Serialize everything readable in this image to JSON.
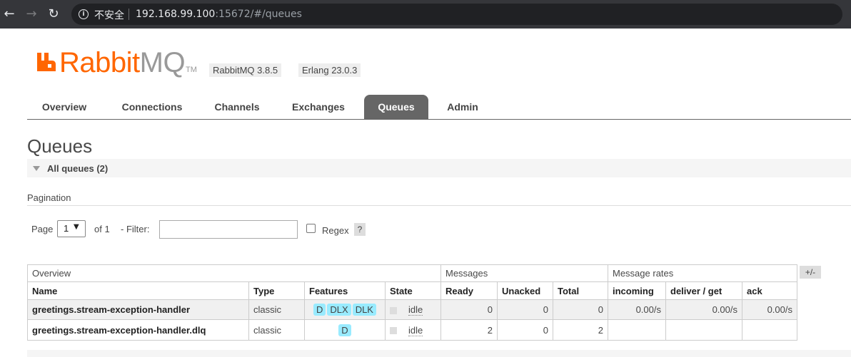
{
  "browser": {
    "security_text": "不安全",
    "url_host": "192.168.99.100",
    "url_rest": ":15672/#/queues"
  },
  "header": {
    "logo_rabbit": "Rabbit",
    "logo_mq": "MQ",
    "logo_tm": "TM",
    "version_rabbitmq": "RabbitMQ 3.8.5",
    "version_erlang": "Erlang 23.0.3",
    "brand_color": "#ff6600"
  },
  "tabs": [
    {
      "label": "Overview"
    },
    {
      "label": "Connections"
    },
    {
      "label": "Channels"
    },
    {
      "label": "Exchanges"
    },
    {
      "label": "Queues",
      "active": true
    },
    {
      "label": "Admin"
    }
  ],
  "main": {
    "title": "Queues",
    "section_label": "All queues (2)",
    "pagination_label": "Pagination",
    "page_word": "Page",
    "page_value": "1",
    "of_text": "of 1",
    "filter_label": "- Filter:",
    "filter_value": "",
    "regex_label": "Regex",
    "help_label": "?",
    "columns_toggle": "+/-"
  },
  "table": {
    "group_headers": [
      "Overview",
      "Messages",
      "Message rates"
    ],
    "headers": [
      "Name",
      "Type",
      "Features",
      "State",
      "Ready",
      "Unacked",
      "Total",
      "incoming",
      "deliver / get",
      "ack"
    ],
    "rows": [
      {
        "name": "greetings.stream-exception-handler",
        "type": "classic",
        "features": [
          "D",
          "DLX",
          "DLK"
        ],
        "state": "idle",
        "ready": "0",
        "unacked": "0",
        "total": "0",
        "incoming": "0.00/s",
        "deliver_get": "0.00/s",
        "ack": "0.00/s"
      },
      {
        "name": "greetings.stream-exception-handler.dlq",
        "type": "classic",
        "features": [
          "D"
        ],
        "state": "idle",
        "ready": "2",
        "unacked": "0",
        "total": "2",
        "incoming": "",
        "deliver_get": "",
        "ack": ""
      }
    ],
    "badge_color": "#99ebff"
  }
}
